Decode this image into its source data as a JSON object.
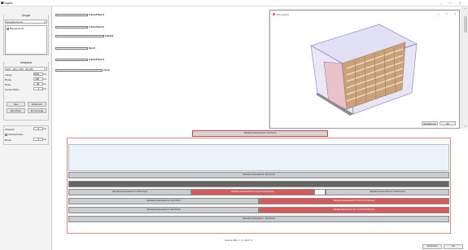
{
  "window": {
    "title": "Eingabe"
  },
  "left_panel": {
    "group1": {
      "title": "Gruppe",
      "combo_value": "Eingabeformat",
      "list_item": "Bauabschnitt"
    },
    "group2": {
      "title": "Leistwerte",
      "combo_value": "RW - 300 x 250 - 80-350",
      "rows": [
        {
          "label": "Länge",
          "value": "4000",
          "unit": "mm"
        },
        {
          "label": "Breite",
          "value": "400",
          "unit": "mm"
        },
        {
          "label": "Höhe",
          "value": "28",
          "unit": "mm"
        },
        {
          "label": "Gesamthöhe",
          "value": "4",
          "unit": "mm"
        }
      ],
      "btn_neu": "Neu",
      "btn_entfernen": "Entfernen",
      "btn_einrichten": "Einrichten",
      "btn_3d": "3D-Anzeige"
    },
    "group3": {
      "row1_label": "Abstand",
      "row1_value": "0",
      "row1_unit": "mm",
      "check_label": "Verbaubrücke",
      "row2_label": "Breite",
      "row2_value": "0",
      "row2_unit": "mm"
    }
  },
  "strip": {
    "items": [
      {
        "label": "Standard Aussenwand 1",
        "size": "1.8x0.3*8x2.8"
      },
      {
        "label": "Standard Aussenwand 2",
        "size": "1.8x0.3*8x2.8"
      },
      {
        "label": "Standard Aussenwand 3",
        "size": "3.8x2.8"
      },
      {
        "label": "Standard Aussenwand 4",
        "size": "8x2.8"
      },
      {
        "label": "Standard Aussenwand 5",
        "size": "0.3x0.3*8x2.8"
      },
      {
        "label": "Standard Aussenwand 6",
        "size": "7x2.8"
      }
    ]
  },
  "win3d": {
    "title": "3D-Ansicht",
    "btn_left": "Aktualisieren",
    "btn_ok": "OK"
  },
  "lower": {
    "top_label": "Standard Aussenwand 8 / 4x0.27x2.8",
    "bars": [
      {
        "text": "Standard Aussenwand 9 / 8x0.27x2.8"
      },
      {
        "text": ""
      },
      {
        "text": "Standard Aussenwand 10 / 2.8x0.27x2.8"
      },
      {
        "text": "Standard Aussenwand 10 / 2.4x0.27x2.8 (Protect)"
      },
      {
        "text": ""
      },
      {
        "text": "Standard Aussenwand 11 / 2.8x0.27x2.8"
      },
      {
        "text": "Standard Aussenwand 14 / 4x0.27x2.8"
      },
      {
        "text": "Standard Aussenwand 15 / 4x0.27x2.8 (Protect)"
      },
      {
        "text": "Standard Aussenwand 17 / 4x0.27x2.8"
      },
      {
        "text": "Standard Aussenwand 18 / 4x0.27x2.8 (Protect)"
      },
      {
        "text": "Standard Aussenwand 7 / 8x0.27x2.8"
      }
    ],
    "footer": "Gesamt: 896 / 1 - 4 / 2024 = 2",
    "btn_abbrechen": "Abbrechen",
    "btn_ok": "OK"
  }
}
